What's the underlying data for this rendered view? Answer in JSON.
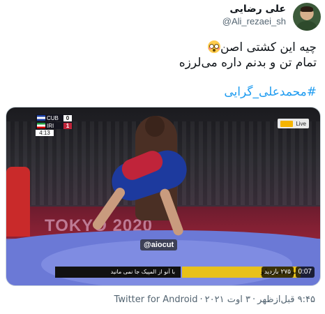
{
  "author": {
    "display_name": "علی رضایی",
    "handle": "@Ali_rezaei_sh"
  },
  "tweet": {
    "line1": "چیه این کشتی اصن",
    "line2": "تمام تن و بدنم داره می‌لرزه",
    "hashtag": "#محمدعلی_گرایی",
    "emoji": "flushed-face-icon"
  },
  "media": {
    "scoreboard": {
      "rows": [
        {
          "code": "CUB",
          "points": "0"
        },
        {
          "code": "IRI",
          "points": "1"
        }
      ],
      "clock": "4:13"
    },
    "live_label": "Live",
    "tokyo_text": "TOKYO 2020",
    "watermark": "@aiocut",
    "subtitle_left": "با آنو از المپیک جا نمی مانید",
    "subtitle_right": "بون اینترنتی آیو",
    "views": "۲۷۵ بازدید",
    "duration": "0:07"
  },
  "meta": {
    "time": "۹:۴۵ قبل‌ازظهر",
    "date": "۳ اوت ۲۰۲۱",
    "source": "Twitter for Android",
    "separator": "·"
  },
  "colors": {
    "link": "#1d9bf0",
    "secondary_text": "#536471"
  }
}
